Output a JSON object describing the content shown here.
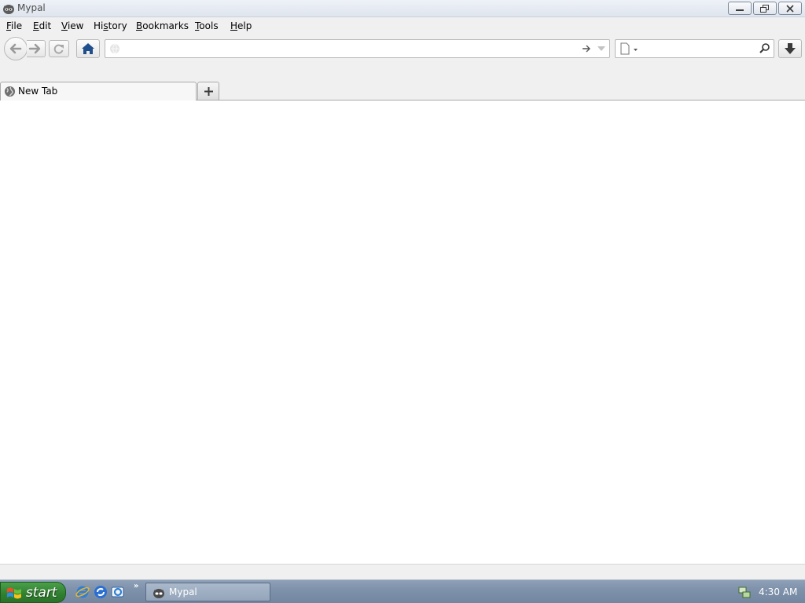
{
  "window": {
    "title": "Mypal"
  },
  "menu": [
    {
      "label": "File",
      "accel": "F",
      "rest": "ile"
    },
    {
      "label": "Edit",
      "accel": "E",
      "rest": "dit"
    },
    {
      "label": "View",
      "accel": "V",
      "rest": "iew"
    },
    {
      "label": "History",
      "pre": "Hi",
      "accel": "s",
      "rest": "tory"
    },
    {
      "label": "Bookmarks",
      "accel": "B",
      "rest": "ookmarks"
    },
    {
      "label": "Tools",
      "accel": "T",
      "rest": "ools"
    },
    {
      "label": "Help",
      "accel": "H",
      "rest": "elp"
    }
  ],
  "urlbar": {
    "value": "",
    "placeholder": ""
  },
  "searchbar": {
    "value": "",
    "placeholder": ""
  },
  "tabs": [
    {
      "label": "New Tab",
      "active": true
    }
  ],
  "taskbar": {
    "start_label": "start",
    "task_label": "Mypal",
    "clock": "4:30 AM",
    "quick_launch_chevron": "»"
  },
  "icons": {
    "app": "raccoon-icon",
    "back": "back-arrow-icon",
    "forward": "forward-arrow-icon",
    "reload": "reload-icon",
    "home": "home-icon",
    "go": "go-arrow-icon",
    "search": "magnifier-icon",
    "download": "download-arrow-icon",
    "new_tab": "plus-icon"
  },
  "colors": {
    "home_icon": "#1f4e8c",
    "start_button": "#3a8a3a",
    "taskbar": "#7f92ab"
  }
}
